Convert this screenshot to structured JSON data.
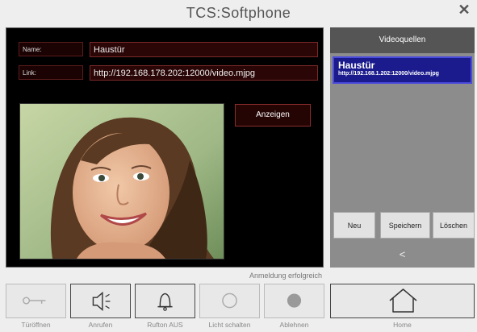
{
  "window": {
    "title": "TCS:Softphone",
    "close_icon": "close-icon"
  },
  "form": {
    "name_label": "Name:",
    "name_value": "Haustür",
    "link_label": "Link:",
    "link_value": "http://192.168.178.202:12000/video.mjpg",
    "show_button": "Anzeigen"
  },
  "sources": {
    "header": "Videoquellen",
    "items": [
      {
        "name": "Haustür",
        "url": "http://192.168.1.202:12000/video.mjpg"
      }
    ],
    "new_button": "Neu",
    "save_button": "Speichern",
    "delete_button": "Löschen",
    "back_glyph": "<"
  },
  "status": "Anmeldung erfolgreich",
  "toolbar": {
    "door_open": "Türöffnen",
    "call": "Anrufen",
    "ringtone_off": "Rufton AUS",
    "light": "Licht schalten",
    "decline": "Ablehnen",
    "home": "Home"
  }
}
